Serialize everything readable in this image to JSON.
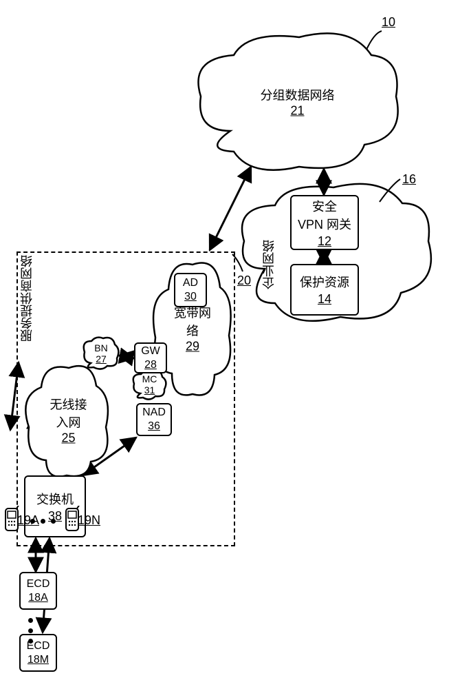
{
  "figureId": "10",
  "enterprise": {
    "label_id": "16",
    "group_label": "企业网络",
    "vpn": {
      "label": "安全\nVPN 网关",
      "num": "12"
    },
    "resource": {
      "label": "保护资源",
      "num": "14"
    }
  },
  "packet_cloud": {
    "label": "分组数据网络",
    "num": "21"
  },
  "sp": {
    "label": "服务提供商网络",
    "label_id": "20",
    "bn": {
      "label": "BN",
      "num": "27"
    },
    "gw": {
      "label": "GW",
      "num": "28"
    },
    "mc": {
      "label": "MC",
      "num": "31"
    },
    "ad": {
      "label": "AD",
      "num": "30"
    },
    "nad": {
      "label": "NAD",
      "num": "36"
    },
    "broadband": {
      "label": "宽带网络",
      "num": "29"
    },
    "access_cloud": {
      "label": "无线接入网",
      "num": "25"
    }
  },
  "switch": {
    "label": "交换机",
    "num": "38"
  },
  "ecd": {
    "a": {
      "label": "ECD",
      "num": "18A"
    },
    "m": {
      "label": "ECD",
      "num": "18M"
    }
  },
  "phones": {
    "a": "19A",
    "n": "19N"
  }
}
